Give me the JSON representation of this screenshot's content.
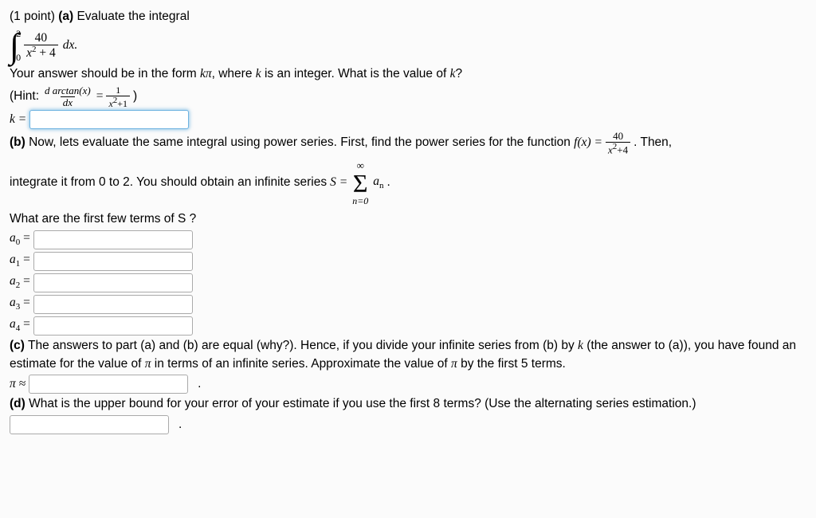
{
  "problem": {
    "points_label": "(1 point)",
    "part_a_label": "(a)",
    "part_a_text": "Evaluate the integral",
    "integral": {
      "lower": "0",
      "upper": "2",
      "numer": "40",
      "denom_left": "x",
      "denom_exp": "2",
      "denom_plus": " + 4",
      "dx": " dx."
    },
    "answer_form_line_pre": "Your answer should be in the form ",
    "kpi": "kπ",
    "answer_form_line_mid": ", where ",
    "k_var": "k",
    "answer_form_line_mid2": " is an integer. What is the value of ",
    "answer_form_line_q": "?",
    "hint_label": "(Hint: ",
    "hint_num": "d arctan(x)",
    "hint_den": "dx",
    "hint_eq": " = ",
    "hint_rhs_num": "1",
    "hint_rhs_den_left": "x",
    "hint_rhs_den_exp": "2",
    "hint_rhs_den_right": "+1",
    "hint_close": " )",
    "k_prompt": "k =",
    "part_b_label": "(b)",
    "part_b_text1": "Now, lets evaluate the same integral using power series. First, find the power series for the function ",
    "fx": "f(x) = ",
    "b_frac_num": "40",
    "b_frac_den_left": "x",
    "b_frac_den_exp": "2",
    "b_frac_den_right": "+4",
    "part_b_text1_end": ". Then,",
    "part_b_text2_pre": "integrate it from 0 to 2. You should obtain an infinite series ",
    "S_eq": "S = ",
    "sigma_top": "∞",
    "sigma_bot": "n=0",
    "an": "a",
    "an_sub": "n",
    "part_b_text2_end": ".",
    "part_b_q": "What are the first few terms of S ?",
    "terms": [
      {
        "label": "a",
        "sub": "0",
        "eq": " ="
      },
      {
        "label": "a",
        "sub": "1",
        "eq": " ="
      },
      {
        "label": "a",
        "sub": "2",
        "eq": " ="
      },
      {
        "label": "a",
        "sub": "3",
        "eq": " ="
      },
      {
        "label": "a",
        "sub": "4",
        "eq": " ="
      }
    ],
    "part_c_label": "(c)",
    "part_c_text": "The answers to part (a) and (b) are equal (why?). Hence, if you divide your infinite series from (b) by ",
    "part_c_text2": " (the answer to (a)), you have found an estimate for the value of ",
    "pi": "π",
    "part_c_text3": " in terms of an infinite series. Approximate the value of ",
    "part_c_text4": " by the first 5 terms.",
    "pi_prompt": "π ≈",
    "part_d_label": "(d)",
    "part_d_text": "What is the upper bound for your error of your estimate if you use the first 8 terms? (Use the alternating series estimation.)",
    "period": "."
  }
}
